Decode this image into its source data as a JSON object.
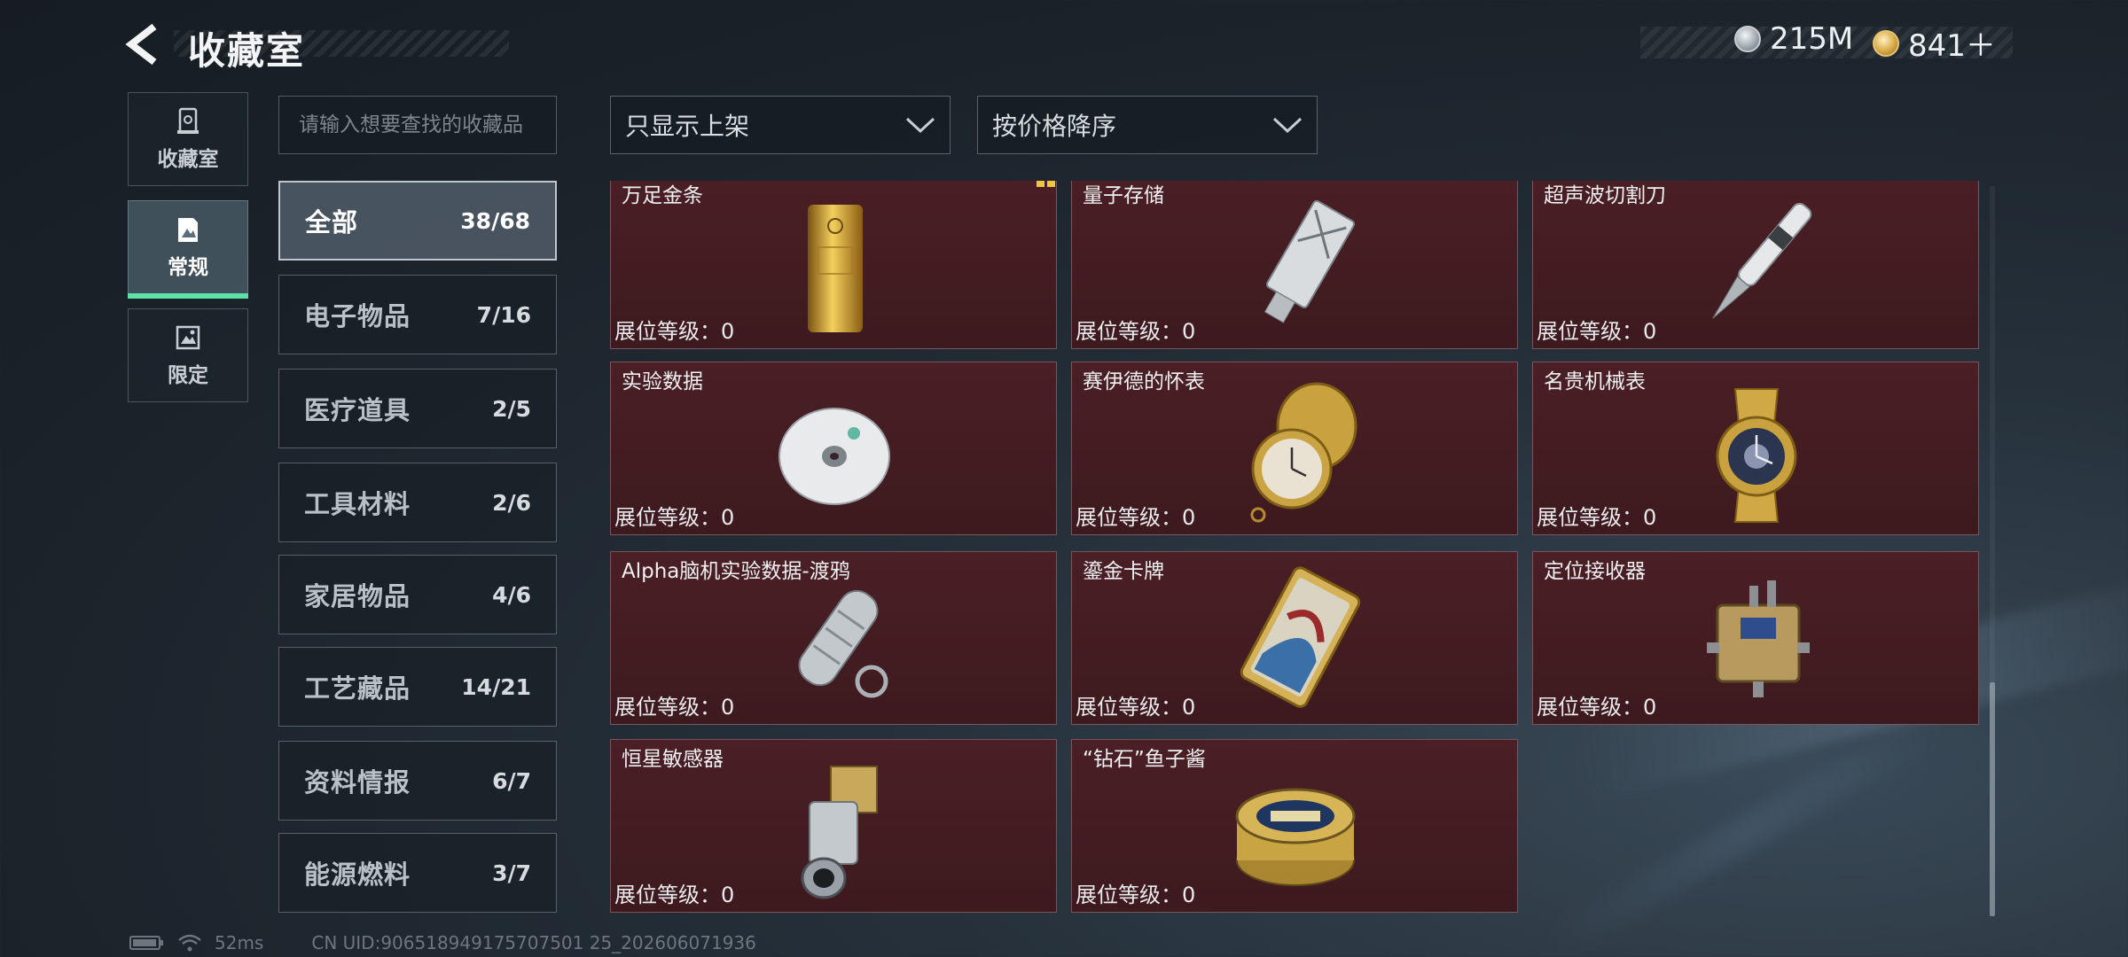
{
  "header": {
    "title": "收藏室",
    "currency": [
      {
        "icon": "silver-coin-icon",
        "value": "215M"
      },
      {
        "icon": "gold-coin-icon",
        "value": "841＋"
      }
    ]
  },
  "nav": {
    "tabs": [
      {
        "label": "收藏室",
        "icon": "collection-room-icon",
        "active": false
      },
      {
        "label": "常规",
        "icon": "regular-icon",
        "active": true
      },
      {
        "label": "限定",
        "icon": "limited-icon",
        "active": false
      }
    ]
  },
  "search": {
    "placeholder": "请输入想要查找的收藏品"
  },
  "filters": {
    "shelf": {
      "value": "只显示上架"
    },
    "sort": {
      "value": "按价格降序"
    }
  },
  "categories": [
    {
      "name": "全部",
      "count": "38/68",
      "active": true
    },
    {
      "name": "电子物品",
      "count": "7/16"
    },
    {
      "name": "医疗道具",
      "count": "2/5"
    },
    {
      "name": "工具材料",
      "count": "2/6"
    },
    {
      "name": "家居物品",
      "count": "4/6"
    },
    {
      "name": "工艺藏品",
      "count": "14/21"
    },
    {
      "name": "资料情报",
      "count": "6/7"
    },
    {
      "name": "能源燃料",
      "count": "3/7"
    }
  ],
  "items": [
    {
      "name": "万足金条",
      "level": "展位等级：0",
      "icon": "gold-bar-icon"
    },
    {
      "name": "量子存储",
      "level": "展位等级：0",
      "icon": "quantum-storage-icon"
    },
    {
      "name": "超声波切割刀",
      "level": "展位等级：0",
      "icon": "ultrasonic-knife-icon"
    },
    {
      "name": "实验数据",
      "level": "展位等级：0",
      "icon": "data-disc-icon"
    },
    {
      "name": "赛伊德的怀表",
      "level": "展位等级：0",
      "icon": "pocket-watch-icon"
    },
    {
      "name": "名贵机械表",
      "level": "展位等级：0",
      "icon": "luxury-watch-icon"
    },
    {
      "name": "Alpha脑机实验数据-渡鸦",
      "level": "展位等级：0",
      "icon": "data-capsule-icon"
    },
    {
      "name": "鎏金卡牌",
      "level": "展位等级：0",
      "icon": "gilded-card-icon"
    },
    {
      "name": "定位接收器",
      "level": "展位等级：0",
      "icon": "locator-receiver-icon"
    },
    {
      "name": "恒星敏感器",
      "level": "展位等级：0",
      "icon": "star-sensor-icon"
    },
    {
      "name": "“钻石”鱼子酱",
      "level": "展位等级：0",
      "icon": "caviar-tin-icon"
    }
  ],
  "footer": {
    "ping": "52ms",
    "uid": "CN UID:906518949175707501 25_202606071936"
  }
}
